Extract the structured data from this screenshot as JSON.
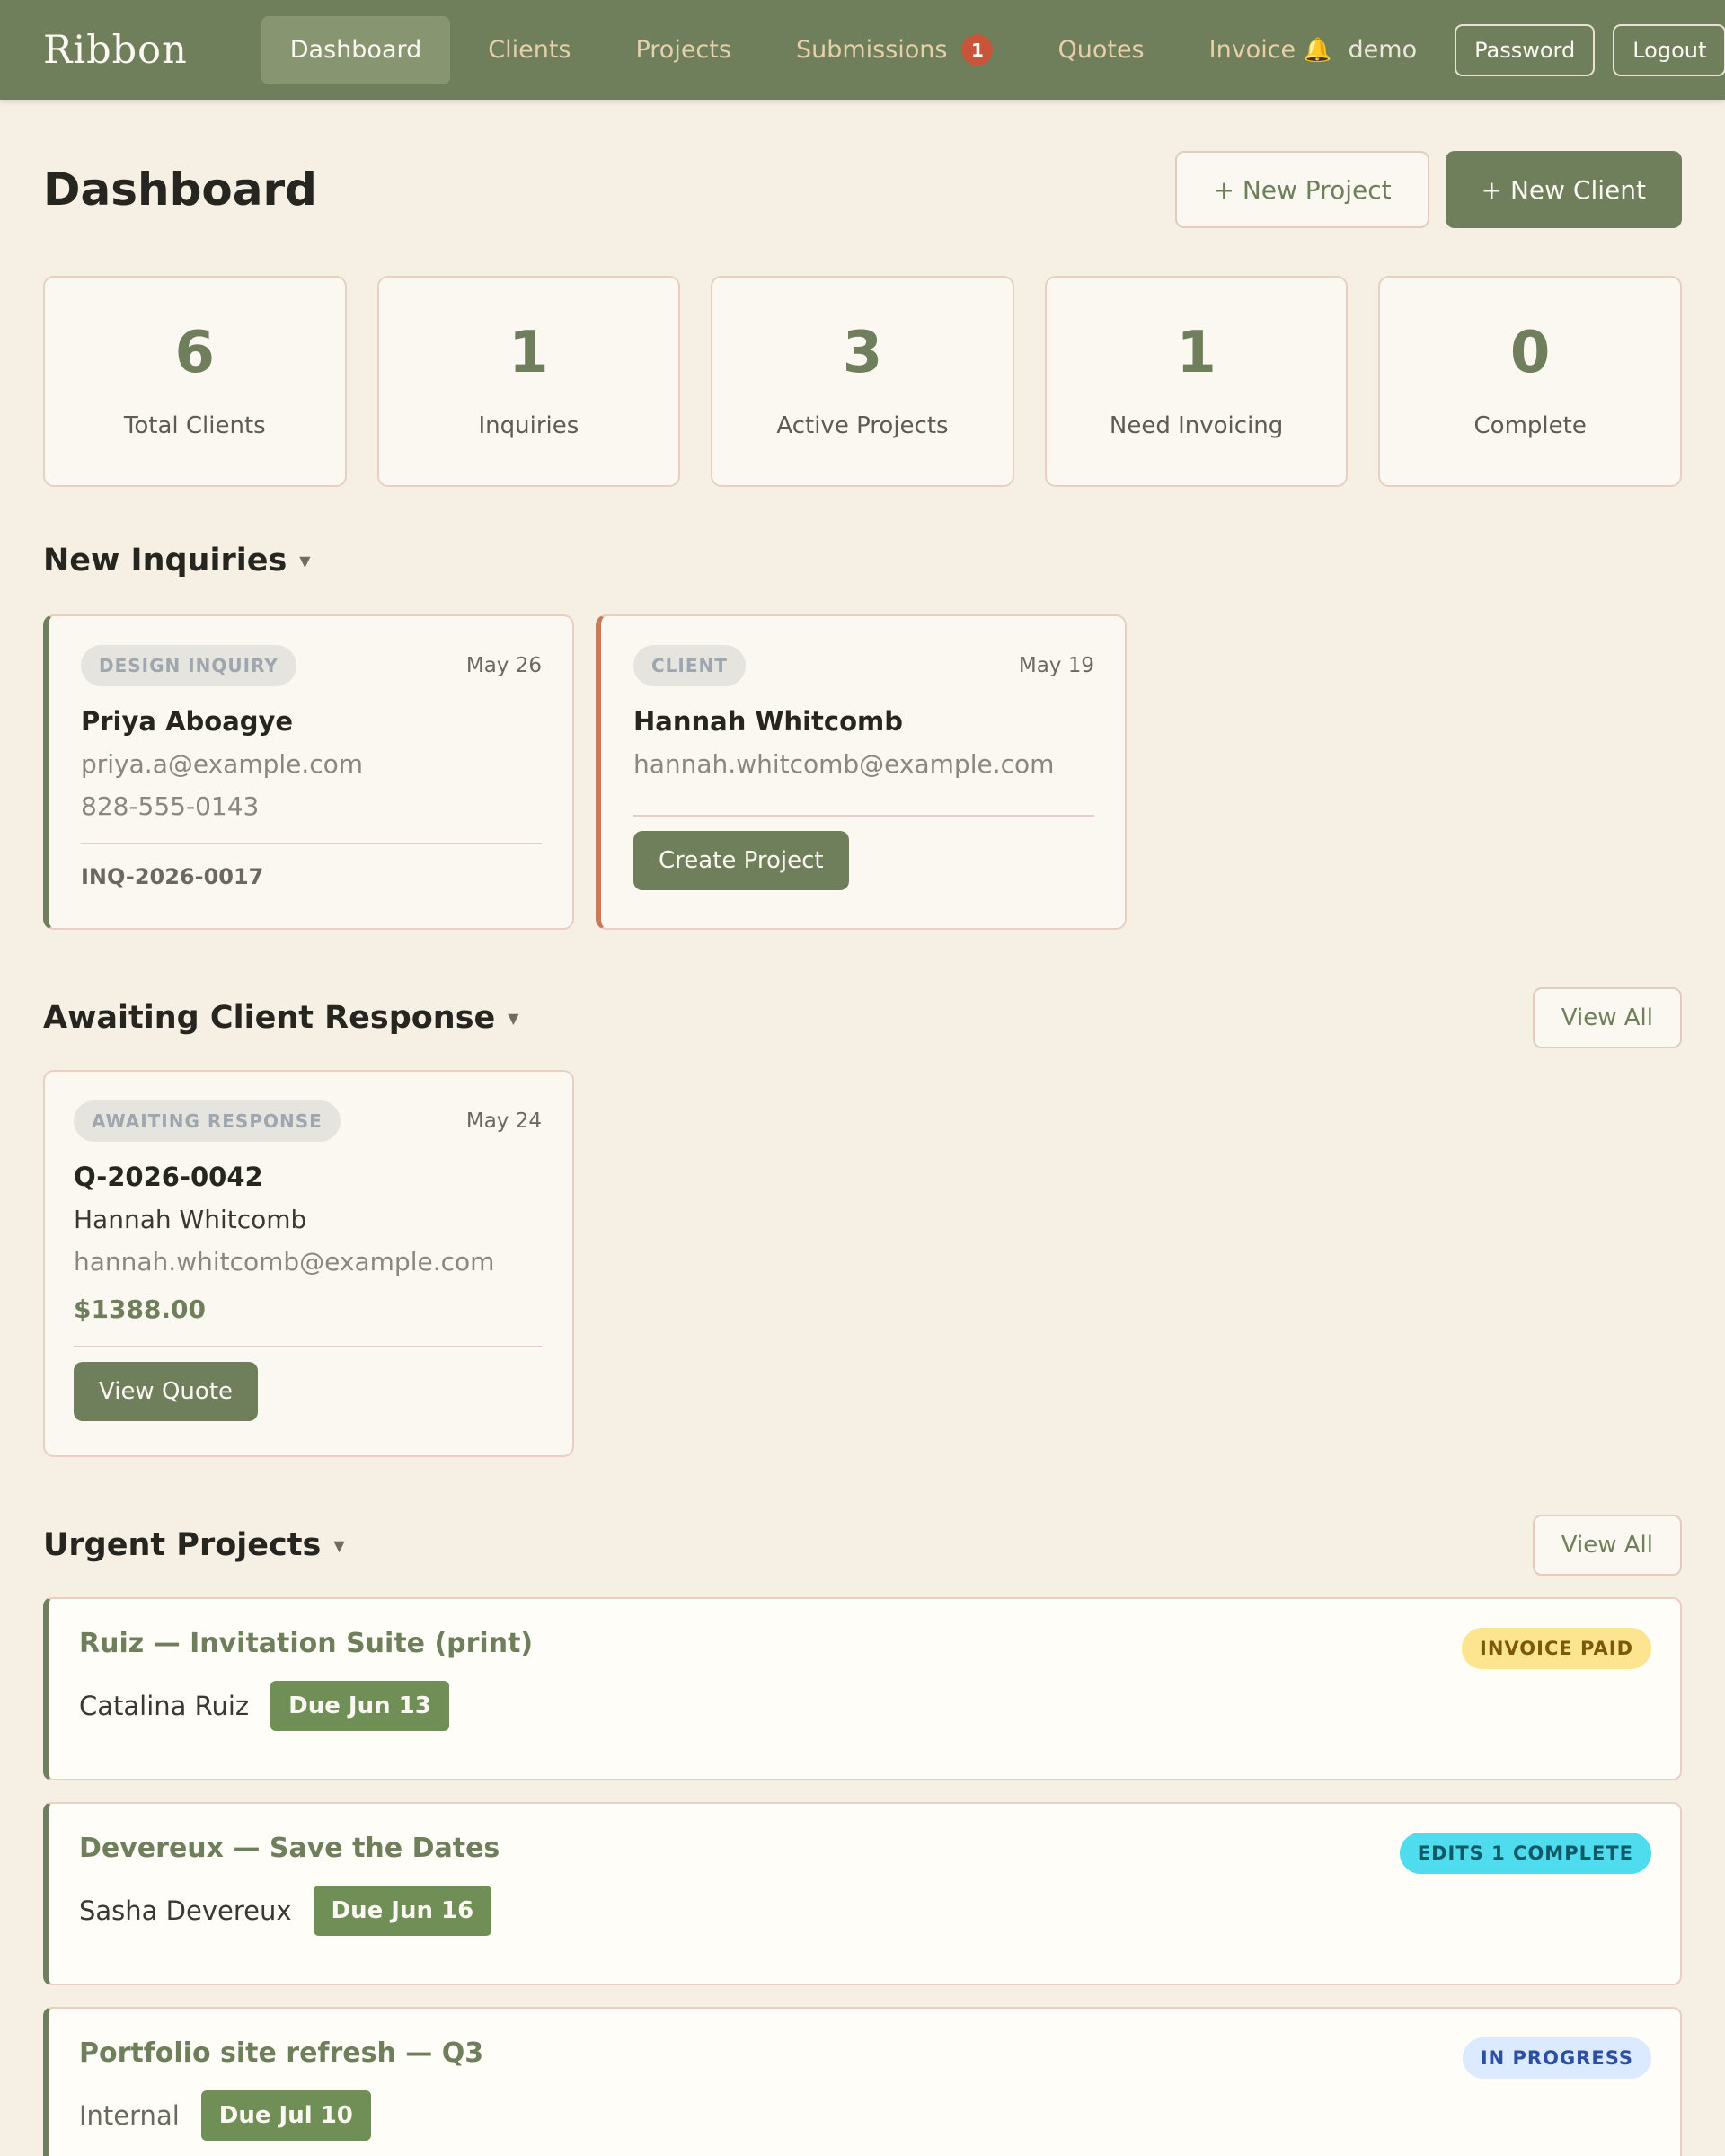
{
  "nav": {
    "brand": "Ribbon",
    "links": [
      {
        "label": "Dashboard"
      },
      {
        "label": "Clients"
      },
      {
        "label": "Projects"
      },
      {
        "label": "Submissions",
        "badge": "1"
      },
      {
        "label": "Quotes"
      },
      {
        "label": "Invoice",
        "icon": "bell-icon"
      }
    ],
    "user": "demo",
    "password_label": "Password",
    "logout_label": "Logout"
  },
  "header": {
    "title": "Dashboard",
    "new_project_label": "+ New Project",
    "new_client_label": "+ New Client"
  },
  "stats": [
    {
      "value": "6",
      "label": "Total Clients"
    },
    {
      "value": "1",
      "label": "Inquiries"
    },
    {
      "value": "3",
      "label": "Active Projects"
    },
    {
      "value": "1",
      "label": "Need Invoicing"
    },
    {
      "value": "0",
      "label": "Complete"
    }
  ],
  "inquiries": {
    "title": "New Inquiries",
    "cards": [
      {
        "tag": "DESIGN INQUIRY",
        "date": "May 26",
        "name": "Priya Aboagye",
        "email": "priya.a@example.com",
        "phone": "828-555-0143",
        "ref": "INQ-2026-0017"
      },
      {
        "tag": "CLIENT",
        "date": "May 19",
        "name": "Hannah Whitcomb",
        "email": "hannah.whitcomb@example.com",
        "action": "Create Project"
      }
    ]
  },
  "awaiting": {
    "title": "Awaiting Client Response",
    "view_all_label": "View All",
    "cards": [
      {
        "tag": "AWAITING RESPONSE",
        "date": "May 24",
        "quote_id": "Q-2026-0042",
        "client": "Hannah Whitcomb",
        "email": "hannah.whitcomb@example.com",
        "amount": "$1388.00",
        "action": "View Quote"
      }
    ]
  },
  "urgent": {
    "title": "Urgent Projects",
    "view_all_label": "View All",
    "projects": [
      {
        "title": "Ruiz — Invitation Suite (print)",
        "client": "Catalina Ruiz",
        "due": "Due Jun 13",
        "status": "INVOICE PAID",
        "status_bg": "#fde58f",
        "status_fg": "#7a5a0a"
      },
      {
        "title": "Devereux — Save the Dates",
        "client": "Sasha Devereux",
        "due": "Due Jun 16",
        "status": "EDITS 1 COMPLETE",
        "status_bg": "#4fdcef",
        "status_fg": "#0d5a66"
      },
      {
        "title": "Portfolio site refresh — Q3",
        "client": "Internal",
        "due": "Due Jul 10",
        "status": "IN PROGRESS",
        "status_bg": "#dbeafe",
        "status_fg": "#2b4fa3"
      }
    ]
  },
  "colors": {
    "nav_bg": "#6f7f5c",
    "accent": "#6f7f5c",
    "page_bg": "#f5efe4",
    "badge": "#c8553a"
  }
}
